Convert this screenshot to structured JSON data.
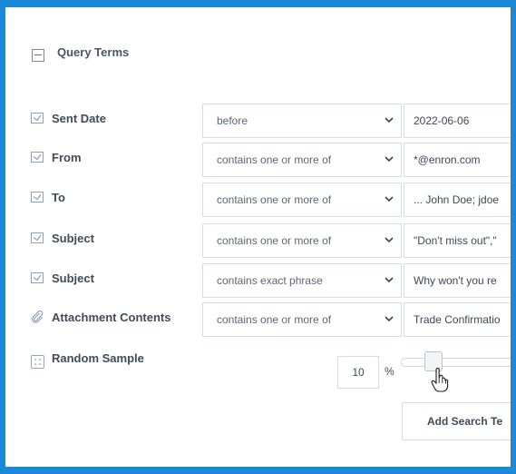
{
  "section": {
    "title": "Query Terms"
  },
  "rows": [
    {
      "icon": "checked-checkbox-icon",
      "label": "Sent Date",
      "operator": "before",
      "value": "2022-06-06"
    },
    {
      "icon": "checked-checkbox-icon",
      "label": "From",
      "operator": "contains one or more of",
      "value": "*@enron.com"
    },
    {
      "icon": "checked-checkbox-icon",
      "label": "To",
      "operator": "contains one or more of",
      "value": "... John Doe; jdoe"
    },
    {
      "icon": "checked-checkbox-icon",
      "label": "Subject",
      "operator": "contains one or more of",
      "value": "\"Don't miss out\",\""
    },
    {
      "icon": "checked-checkbox-icon",
      "label": "Subject",
      "operator": "contains exact phrase",
      "value": "Why won't you re"
    },
    {
      "icon": "paperclip-icon",
      "label": "Attachment Contents",
      "operator": "contains one or more of",
      "value": "Trade Confirmatio"
    }
  ],
  "random_sample": {
    "label": "Random Sample",
    "percent_value": "10",
    "percent_sign": "%",
    "slider_level_percent": 10
  },
  "add_button": {
    "label": "Add Search Te"
  },
  "colors": {
    "frame": "#1a8ad8",
    "checkbox": "#8fa1b4",
    "text": "#404b57"
  }
}
